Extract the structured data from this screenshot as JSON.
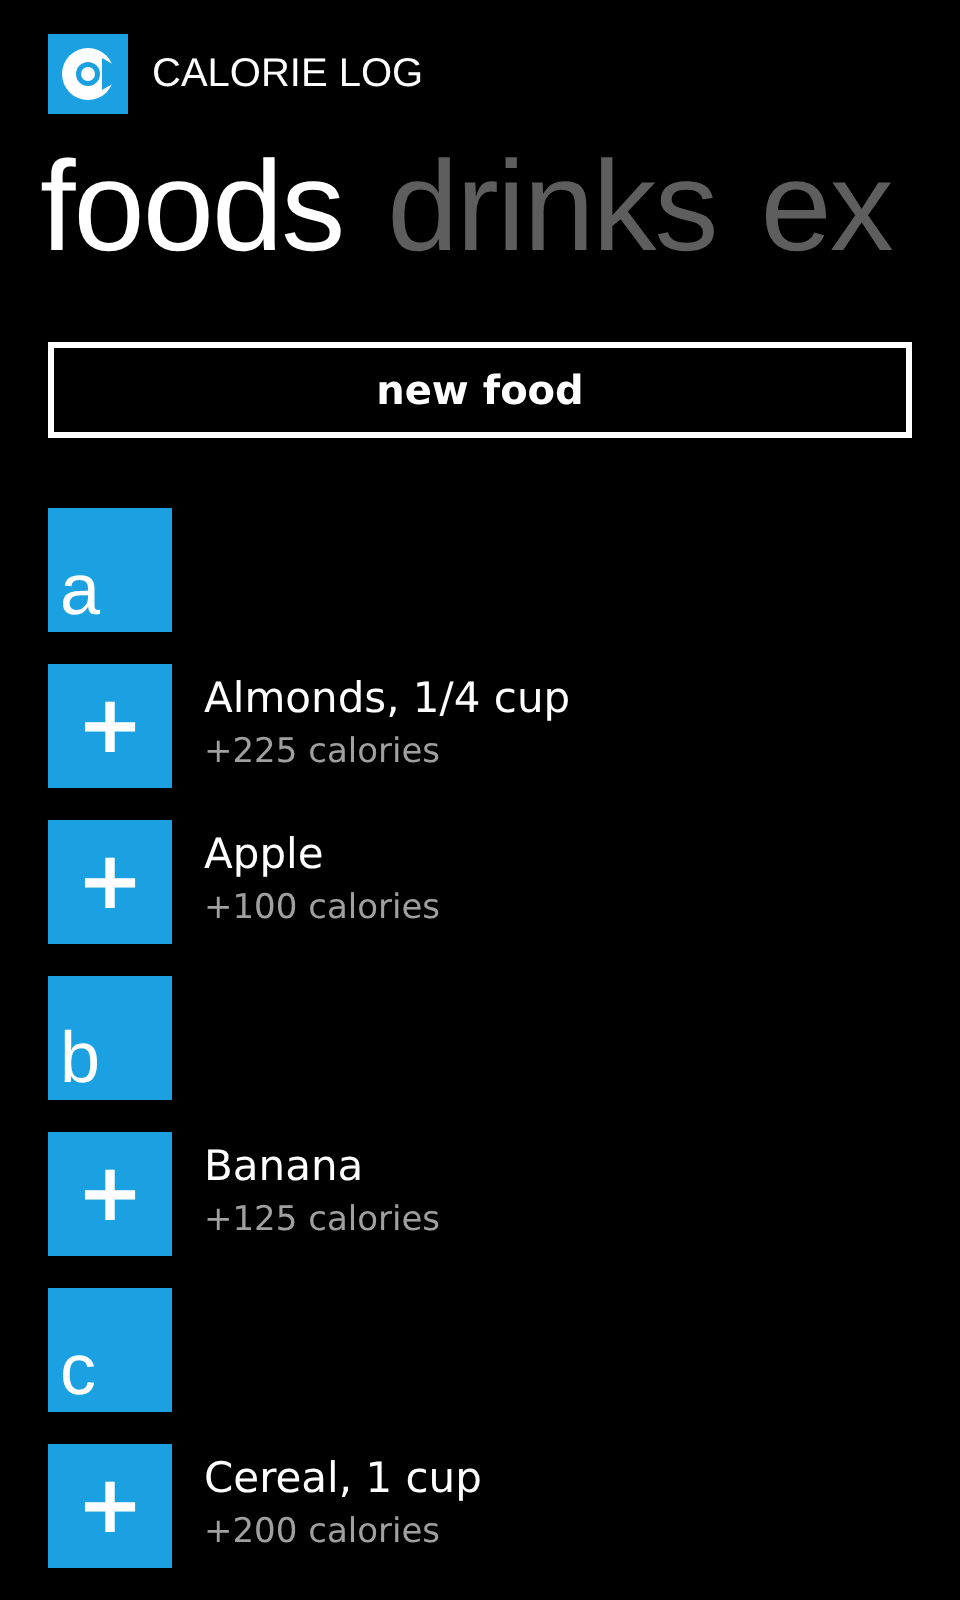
{
  "app_title": "CALORIE LOG",
  "pivots": [
    {
      "label": "foods",
      "selected": true
    },
    {
      "label": "drinks",
      "selected": false
    },
    {
      "label": "ex",
      "selected": false
    }
  ],
  "new_button": "new food",
  "items": [
    {
      "kind": "letter",
      "label": "a"
    },
    {
      "kind": "food",
      "icon": "+",
      "name": "Almonds, 1/4 cup",
      "calories": "+225 calories"
    },
    {
      "kind": "food",
      "icon": "+",
      "name": "Apple",
      "calories": "+100 calories"
    },
    {
      "kind": "letter",
      "label": "b"
    },
    {
      "kind": "food",
      "icon": "+",
      "name": "Banana",
      "calories": "+125 calories"
    },
    {
      "kind": "letter",
      "label": "c"
    },
    {
      "kind": "food",
      "icon": "+",
      "name": "Cereal, 1 cup",
      "calories": "+200 calories"
    }
  ]
}
